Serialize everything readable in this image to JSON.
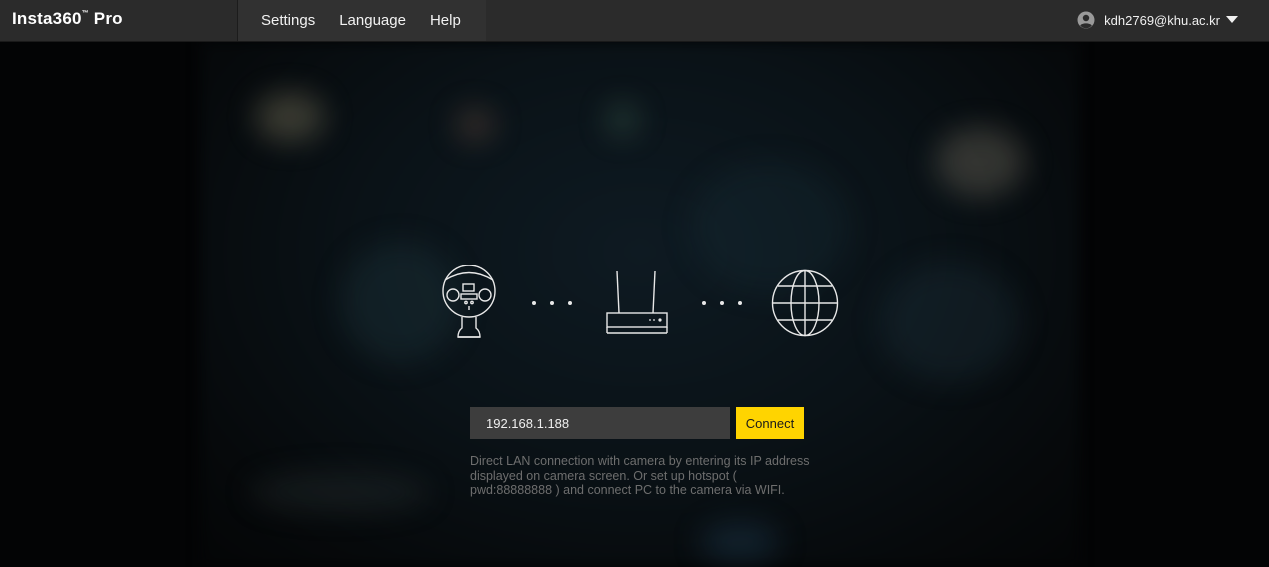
{
  "app": {
    "logo_text": "Insta360",
    "logo_tm": "™",
    "logo_suffix": " Pro"
  },
  "menu": {
    "items": [
      {
        "label": "Settings"
      },
      {
        "label": "Language"
      },
      {
        "label": "Help"
      }
    ]
  },
  "account": {
    "email": "kdh2769@khu.ac.kr",
    "icon": "user-avatar-icon",
    "dropdown_icon": "caret-down-icon"
  },
  "diagram": {
    "icons": [
      "camera-icon",
      "router-icon",
      "globe-icon"
    ]
  },
  "connect": {
    "ip_value": "192.168.1.188",
    "button_label": "Connect",
    "help_text": "Direct LAN connection with camera by entering its IP address displayed on camera screen. Or set up hotspot ( pwd:88888888 ) and connect PC to the camera via WIFI."
  },
  "colors": {
    "topbar": "#2b2b2b",
    "accent": "#ffd400",
    "input_bg": "#3d3d3d",
    "help_text": "#6e6e6e"
  }
}
